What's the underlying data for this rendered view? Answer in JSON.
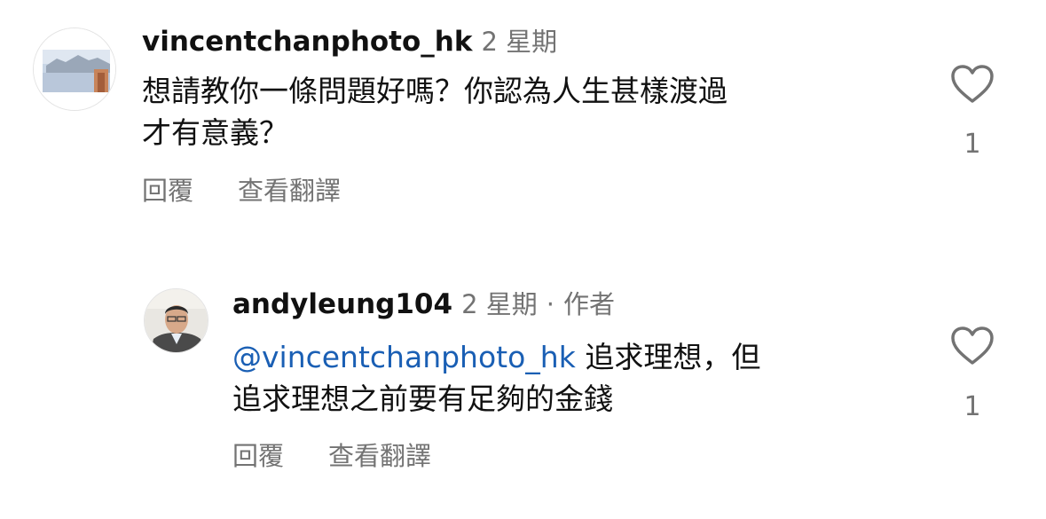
{
  "comments": [
    {
      "username": "vincentchanphoto_hk",
      "time": "2 星期",
      "text_line1": "想請教你一條問題好嗎？你認為人生甚樣渡過",
      "text_line2": "才有意義？",
      "reply_label": "回覆",
      "translate_label": "查看翻譯",
      "like_count": "1",
      "avatar_icon": "landscape-avatar"
    },
    {
      "username": "andyleung104",
      "time": "2 星期",
      "separator": "·",
      "author_badge": "作者",
      "mention": "@vincentchanphoto_hk",
      "text_line1_rest": " 追求理想，但",
      "text_line2": "追求理想之前要有足夠的金錢",
      "reply_label": "回覆",
      "translate_label": "查看翻譯",
      "like_count": "1",
      "avatar_icon": "person-avatar"
    }
  ],
  "colors": {
    "mention": "#1a5fb4",
    "meta": "#737373",
    "text": "#111111"
  },
  "icons": {
    "like": "heart-outline-icon"
  }
}
